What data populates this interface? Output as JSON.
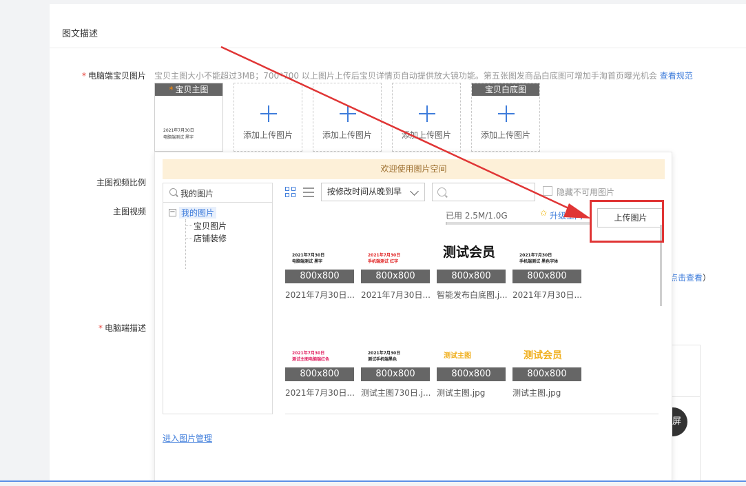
{
  "section": {
    "title": "图文描述"
  },
  "form": {
    "pc_image_label": "电脑端宝贝图片",
    "hint_text": "宝贝主图大小不能超过3MB；700*700 以上图片上传后宝贝详情页自动提供放大镜功能。第五张图发商品白底图可增加手淘首页曝光机会",
    "hint_link": "查看规范",
    "video_ratio_label": "主图视频比例",
    "main_video_label": "主图视频",
    "pc_desc_label": "电脑端描述",
    "side_link": "点击查看",
    "side_paren": "）",
    "fullscreen_char": "屏"
  },
  "slots": {
    "main_tag": "宝贝主图",
    "main_thumb_line1": "2021年7月30日",
    "main_thumb_line2": "电脑端测试 黑字",
    "white_tag": "宝贝白底图",
    "add_label": "添加上传图片"
  },
  "panel": {
    "banner": "欢迎使用图片空间",
    "tree_search": "我的图片",
    "tree_root": "我的图片",
    "tree_children": [
      "宝贝图片",
      "店铺装修"
    ],
    "sort_value": "按修改时间从晚到早",
    "hide_label": "隐藏不可用图片",
    "usage_text": "已用 2.5M/1.0G",
    "usage_fraction": 0.003,
    "upgrade_text": "升级空间",
    "upload_button": "上传图片",
    "big_title": "测试会员",
    "manage_link": "进入图片管理",
    "tiles": [
      {
        "size": "800x800",
        "name": "2021年7月30日...",
        "l1": "2021年7月30日",
        "l2": "电脑端测试 黑字",
        "c1": "#222222",
        "c2": "#222222"
      },
      {
        "size": "800x800",
        "name": "2021年7月30日...",
        "l1": "2021年7月30日",
        "l2": "手机端测试 红字",
        "c1": "#e02020",
        "c2": "#e02020"
      },
      {
        "size": "800x800",
        "name": "智能发布白底图.j...",
        "l1": "",
        "l2": "",
        "c1": "#222222",
        "c2": "#222222"
      },
      {
        "size": "800x800",
        "name": "2021年7月30日...",
        "l1": "2021年7月30日",
        "l2": "手机端测试 黑色字体",
        "c1": "#222222",
        "c2": "#222222"
      },
      {
        "size": "800x800",
        "name": "2021年7月30日...",
        "l1": "2021年7月30日",
        "l2": "测试主图电脑端红色",
        "c1": "#e02060",
        "c2": "#e02060"
      },
      {
        "size": "800x800",
        "name": "测试主图730日.j...",
        "l1": "2021年7月30日",
        "l2": "测试手机端黑色",
        "c1": "#222222",
        "c2": "#222222"
      },
      {
        "size": "800x800",
        "name": "测试主图.jpg",
        "l1": "测试主图",
        "l2": "",
        "c1": "#f0b020",
        "c2": "#f0b020"
      },
      {
        "size": "800x800",
        "name": "测试主图.jpg",
        "l1": "测试会员",
        "l2": "",
        "c1": "#f0b020",
        "c2": "#f0b020"
      }
    ]
  },
  "colors": {
    "accent": "#3f7ddb",
    "annotation_red": "#e03535",
    "required": "#e8453c"
  }
}
